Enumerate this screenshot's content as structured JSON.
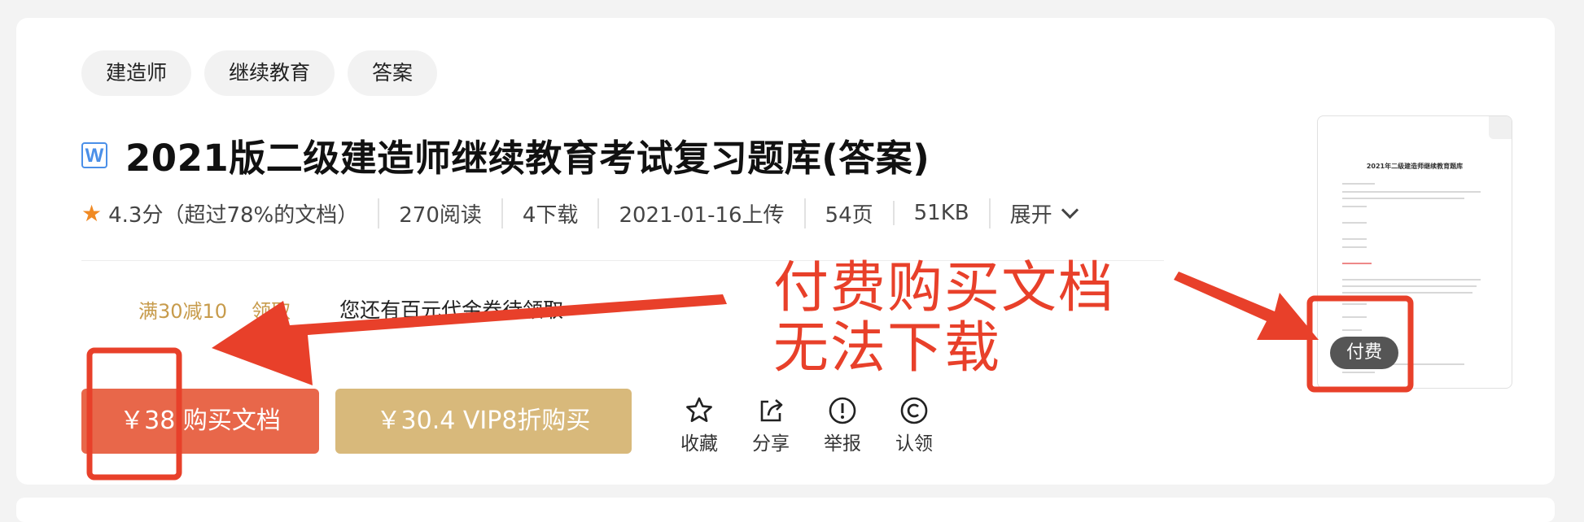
{
  "tags": [
    "建造师",
    "继续教育",
    "答案"
  ],
  "file_type_icon": "W",
  "title": "2021版二级建造师继续教育考试复习题库(答案)",
  "meta": {
    "rating": "4.3分（超过78%的文档）",
    "reads": "270阅读",
    "downloads": "4下载",
    "uploaded": "2021-01-16上传",
    "pages": "54页",
    "size": "51KB",
    "expand": "展开"
  },
  "coupon": {
    "amount": "满30减10",
    "claim": "领取",
    "tip": "您还有百元代金券待领取"
  },
  "buttons": {
    "buy": "￥38 购买文档",
    "vip": "￥30.4 VIP8折购买"
  },
  "actions": {
    "favorite": "收藏",
    "share": "分享",
    "report": "举报",
    "claim": "认领"
  },
  "preview": {
    "doc_title": "2021年二级建造师继续教育题库",
    "badge": "付费"
  },
  "annotation": {
    "line1": "付费购买文档",
    "line2": "无法下载",
    "color": "#e8402a"
  },
  "colors": {
    "buy_button": "#e8674a",
    "vip_button": "#d8b97b",
    "coupon_text": "#c79b4b",
    "rating_star": "#f08a24",
    "word_icon": "#4a8fe8"
  }
}
